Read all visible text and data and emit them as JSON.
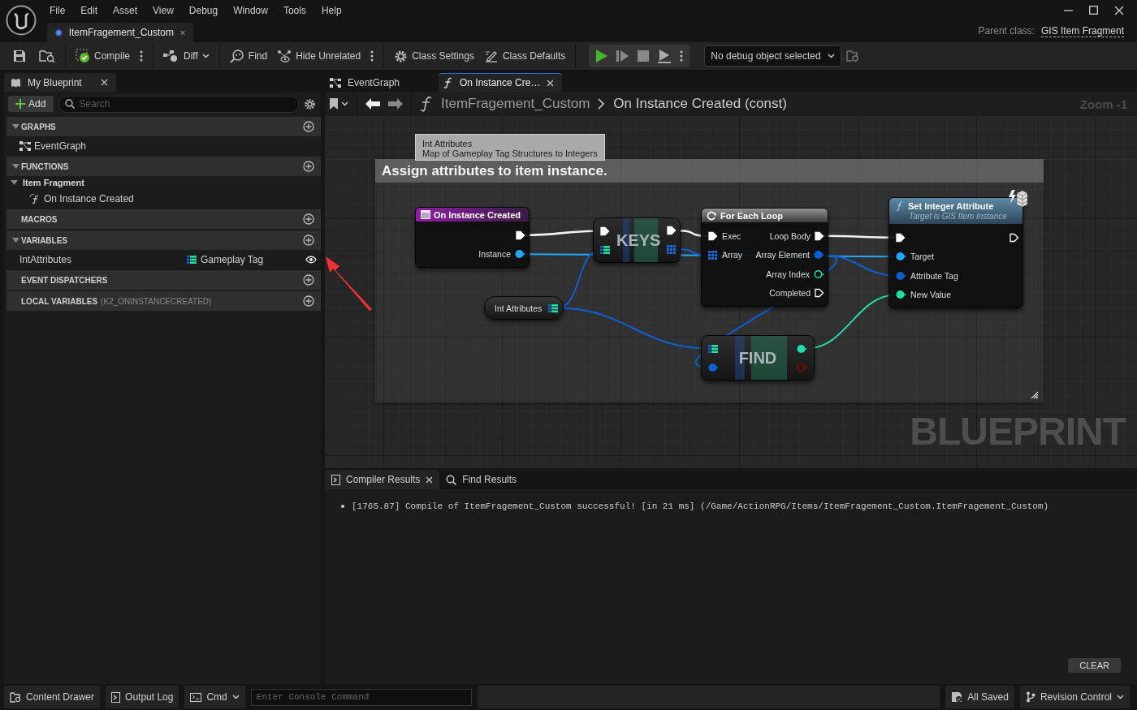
{
  "menu": [
    "File",
    "Edit",
    "Asset",
    "View",
    "Debug",
    "Window",
    "Tools",
    "Help"
  ],
  "document_tab": {
    "title": "ItemFragement_Custom"
  },
  "parent_class": {
    "label": "Parent class:",
    "value": "GIS Item Fragment"
  },
  "toolbar": {
    "compile": "Compile",
    "diff": "Diff",
    "find": "Find",
    "hide_unrelated": "Hide Unrelated",
    "class_settings": "Class Settings",
    "class_defaults": "Class Defaults",
    "debug_object": "No debug object selected"
  },
  "my_blueprint": {
    "tab": "My Blueprint",
    "add": "Add",
    "search_placeholder": "Search",
    "sections": [
      {
        "title": "GRAPHS",
        "expanded": true,
        "children": [
          {
            "kind": "graph",
            "label": "EventGraph"
          }
        ]
      },
      {
        "title": "FUNCTIONS",
        "expanded": true,
        "children": [
          {
            "kind": "category",
            "label": "Item Fragment",
            "expanded": true,
            "children": [
              {
                "kind": "function",
                "label": "On Instance Created"
              }
            ]
          }
        ]
      },
      {
        "title": "MACROS",
        "expanded": false
      },
      {
        "title": "VARIABLES",
        "expanded": true,
        "children": [
          {
            "kind": "variable",
            "label": "IntAttributes",
            "type": "Gameplay Tag"
          }
        ]
      },
      {
        "title": "EVENT DISPATCHERS",
        "expanded": false
      },
      {
        "title": "LOCAL VARIABLES",
        "note": "(K2_ONINSTANCECREATED)",
        "expanded": false
      }
    ]
  },
  "graph_tabs": [
    {
      "kind": "graph",
      "label": "EventGraph",
      "selected": false
    },
    {
      "kind": "function",
      "label": "On Instance Cre…",
      "selected": true
    }
  ],
  "breadcrumb": [
    "ItemFragement_Custom",
    "On Instance Created (const)"
  ],
  "zoom": "Zoom -1",
  "graph": {
    "comment": "Assign attributes to item instance.",
    "tooltip": {
      "title": "Int Attributes",
      "text": "Map of Gameplay Tag Structures to Integers"
    },
    "label": "BLUEPRINT",
    "nodes": [
      {
        "kind": "event",
        "title": "On Instance Created",
        "outputs": [
          {
            "kind": "exec",
            "connected": true
          },
          {
            "kind": "object",
            "label": "Instance",
            "connected": true
          }
        ]
      },
      {
        "kind": "compact",
        "title": "KEYS",
        "inputs": [
          {
            "kind": "exec",
            "connected": true
          },
          {
            "kind": "map",
            "connected": true
          }
        ],
        "outputs": [
          {
            "kind": "exec",
            "connected": true
          },
          {
            "kind": "array",
            "connected": true
          }
        ]
      },
      {
        "kind": "loop",
        "title": "For Each Loop",
        "inputs": [
          {
            "kind": "exec",
            "label": "Exec",
            "connected": true
          },
          {
            "kind": "array",
            "label": "Array",
            "connected": true
          }
        ],
        "outputs": [
          {
            "kind": "exec",
            "label": "Loop Body",
            "connected": true
          },
          {
            "kind": "struct",
            "label": "Array Element",
            "connected": true
          },
          {
            "kind": "int",
            "label": "Array Index",
            "connected": false
          },
          {
            "kind": "exec",
            "label": "Completed",
            "connected": false
          }
        ]
      },
      {
        "kind": "function",
        "title": "Set Integer Attribute",
        "subtitle": "Target is GIS Item Instance",
        "inputs": [
          {
            "kind": "exec",
            "connected": true
          },
          {
            "kind": "object",
            "label": "Target",
            "connected": true
          },
          {
            "kind": "struct",
            "label": "Attribute Tag",
            "connected": true
          },
          {
            "kind": "int",
            "label": "New Value",
            "connected": true
          }
        ],
        "outputs": [
          {
            "kind": "exec",
            "connected": false
          }
        ]
      },
      {
        "kind": "variable",
        "title": "Int Attributes",
        "outputs": [
          {
            "kind": "map",
            "connected": true
          }
        ]
      },
      {
        "kind": "compact",
        "title": "FIND",
        "inputs": [
          {
            "kind": "map",
            "connected": true
          },
          {
            "kind": "struct",
            "connected": true
          }
        ],
        "outputs": [
          {
            "kind": "int",
            "connected": true
          },
          {
            "kind": "bool",
            "connected": false
          }
        ]
      }
    ]
  },
  "results_tabs": [
    {
      "label": "Compiler Results",
      "selected": true
    },
    {
      "label": "Find Results",
      "selected": false
    }
  ],
  "messages": [
    "[1765.87] Compile of ItemFragement_Custom successful! [in 21 ms] (/Game/ActionRPG/Items/ItemFragement_Custom.ItemFragement_Custom)"
  ],
  "clear": "CLEAR",
  "status_bar": {
    "content_drawer": "Content Drawer",
    "output_log": "Output Log",
    "cmd": "Cmd",
    "console_placeholder": "Enter Console Command",
    "saved": "All Saved",
    "revision": "Revision Control"
  }
}
